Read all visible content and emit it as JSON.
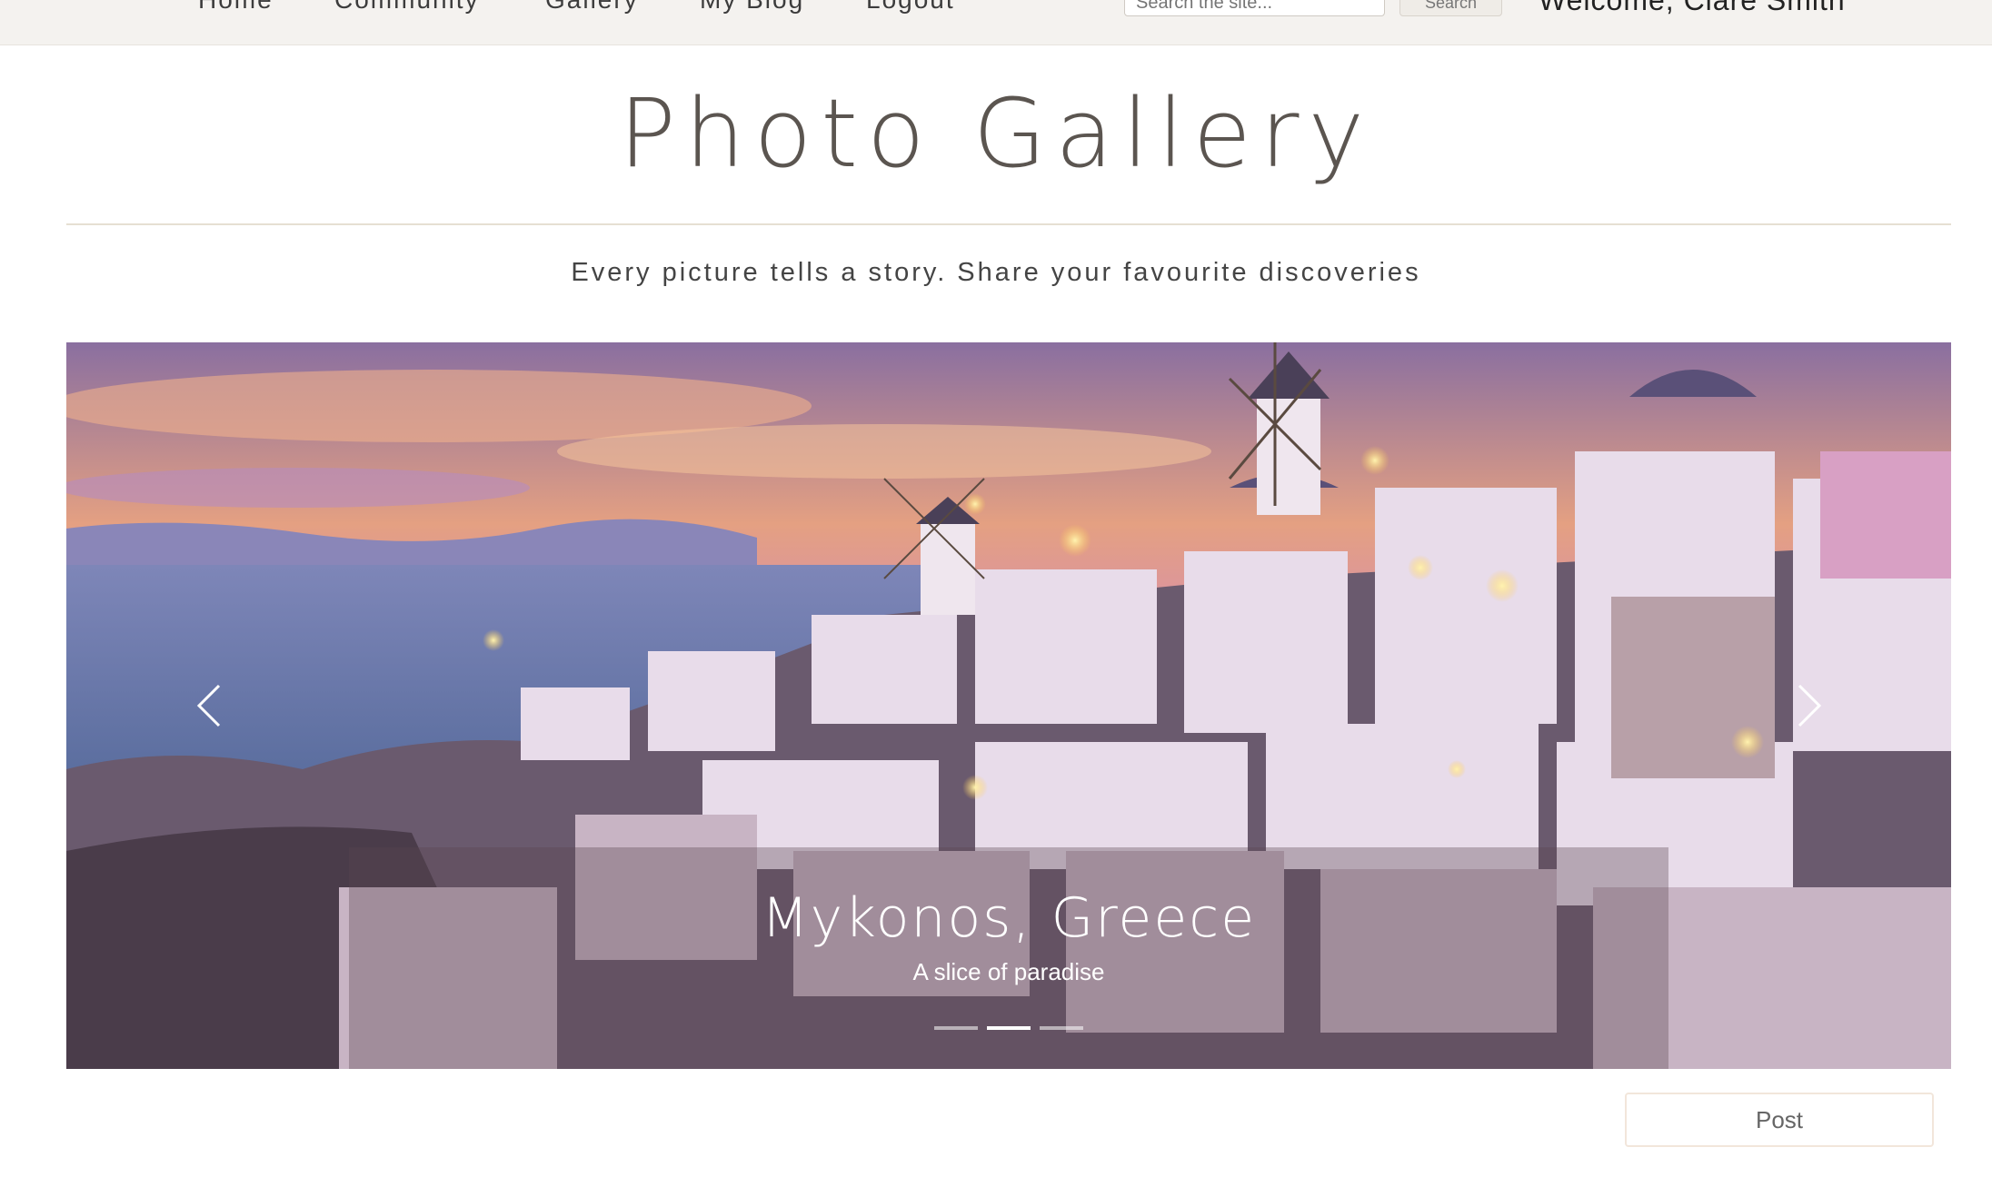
{
  "nav": {
    "items": [
      {
        "label": "Home"
      },
      {
        "label": "Community"
      },
      {
        "label": "Gallery"
      },
      {
        "label": "My Blog"
      },
      {
        "label": "Logout"
      }
    ],
    "search": {
      "placeholder": "Search the site...",
      "button_label": "Search"
    },
    "welcome": "Welcome, Clare Smith"
  },
  "page": {
    "title": "Photo Gallery",
    "tagline": "Every picture tells a story. Share your favourite discoveries"
  },
  "carousel": {
    "slide_title": "Mykonos, Greece",
    "slide_subtitle": "A slice of paradise",
    "slide_count": 3,
    "active_index": 1,
    "prev_icon": "chevron-left-icon",
    "next_icon": "chevron-right-icon"
  },
  "actions": {
    "post_label": "Post"
  },
  "colors": {
    "topbar_bg": "#f4f2ef",
    "title_text": "#5b5550",
    "rule": "#e6dfd3",
    "post_border": "#f2e6db"
  }
}
